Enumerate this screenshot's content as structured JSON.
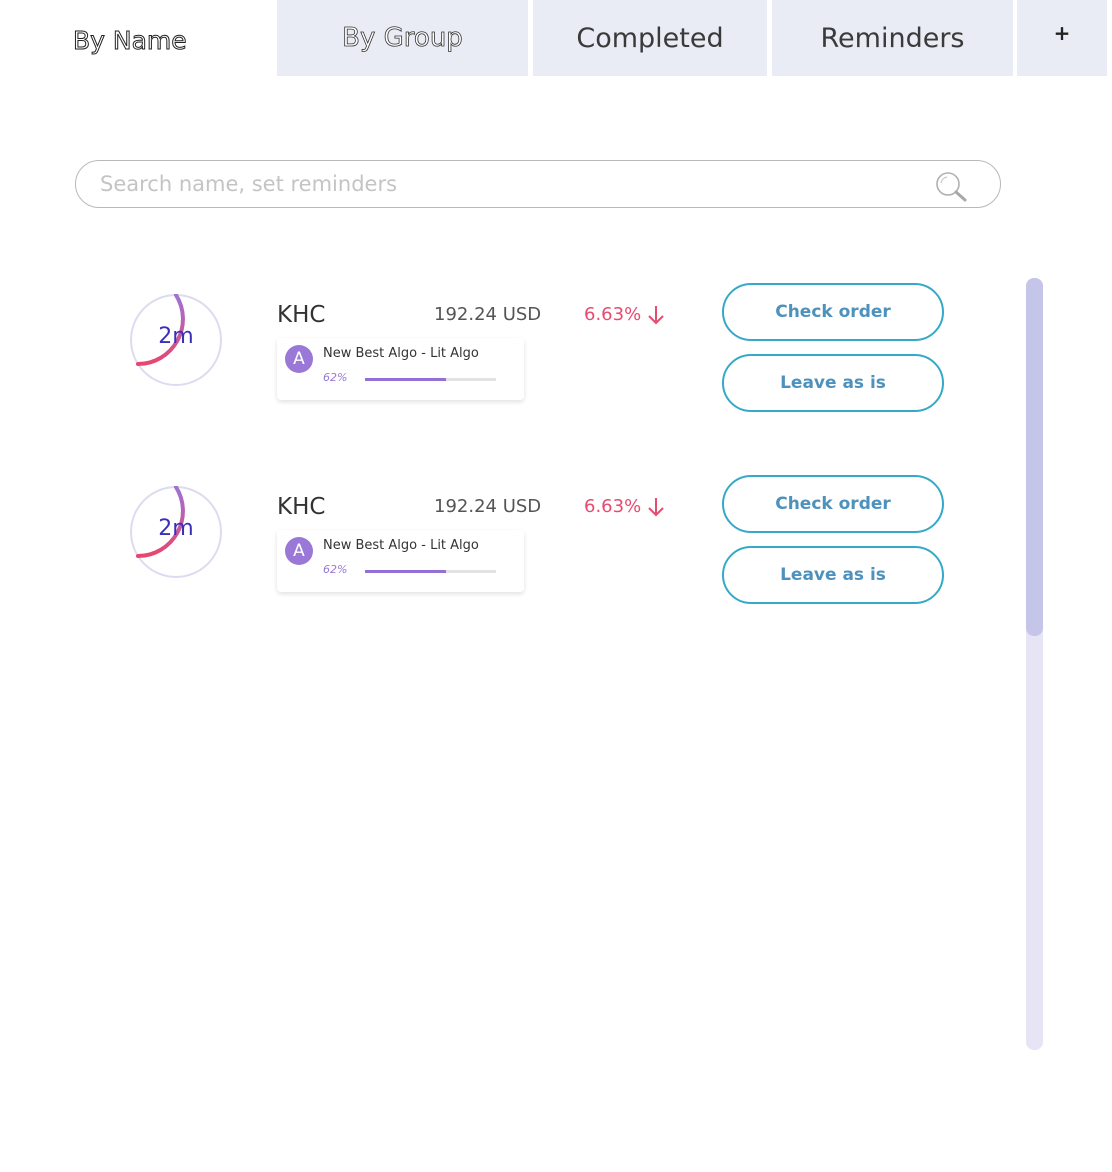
{
  "tabs": [
    {
      "label": "By Name",
      "active": true
    },
    {
      "label": "By Group",
      "active": false
    },
    {
      "label": "Completed",
      "active": false
    },
    {
      "label": "Reminders",
      "active": false
    },
    {
      "label": "+",
      "active": false
    }
  ],
  "search": {
    "placeholder": "Search name, set reminders",
    "icon": "search-icon"
  },
  "colors": {
    "accent_teal": "#35a9c7",
    "button_text": "#4d91bd",
    "negative": "#e84a6f",
    "timer_text": "#3b2fb8",
    "algo_purple": "#9370d6",
    "tab_bg": "#e9ecf4"
  },
  "orders": [
    {
      "timer": "2m",
      "ticker": "KHC",
      "price": "192.24 USD",
      "change": "6.63%",
      "change_direction": "down",
      "algo": {
        "avatar": "A",
        "name": "New Best Algo - Lit Algo",
        "progress_label": "62%",
        "progress": 0.62
      },
      "actions": {
        "check_label": "Check order",
        "leave_label": "Leave as is"
      }
    },
    {
      "timer": "2m",
      "ticker": "KHC",
      "price": "192.24 USD",
      "change": "6.63%",
      "change_direction": "down",
      "algo": {
        "avatar": "A",
        "name": "New Best Algo - Lit Algo",
        "progress_label": "62%",
        "progress": 0.62
      },
      "actions": {
        "check_label": "Check order",
        "leave_label": "Leave as is"
      }
    }
  ]
}
